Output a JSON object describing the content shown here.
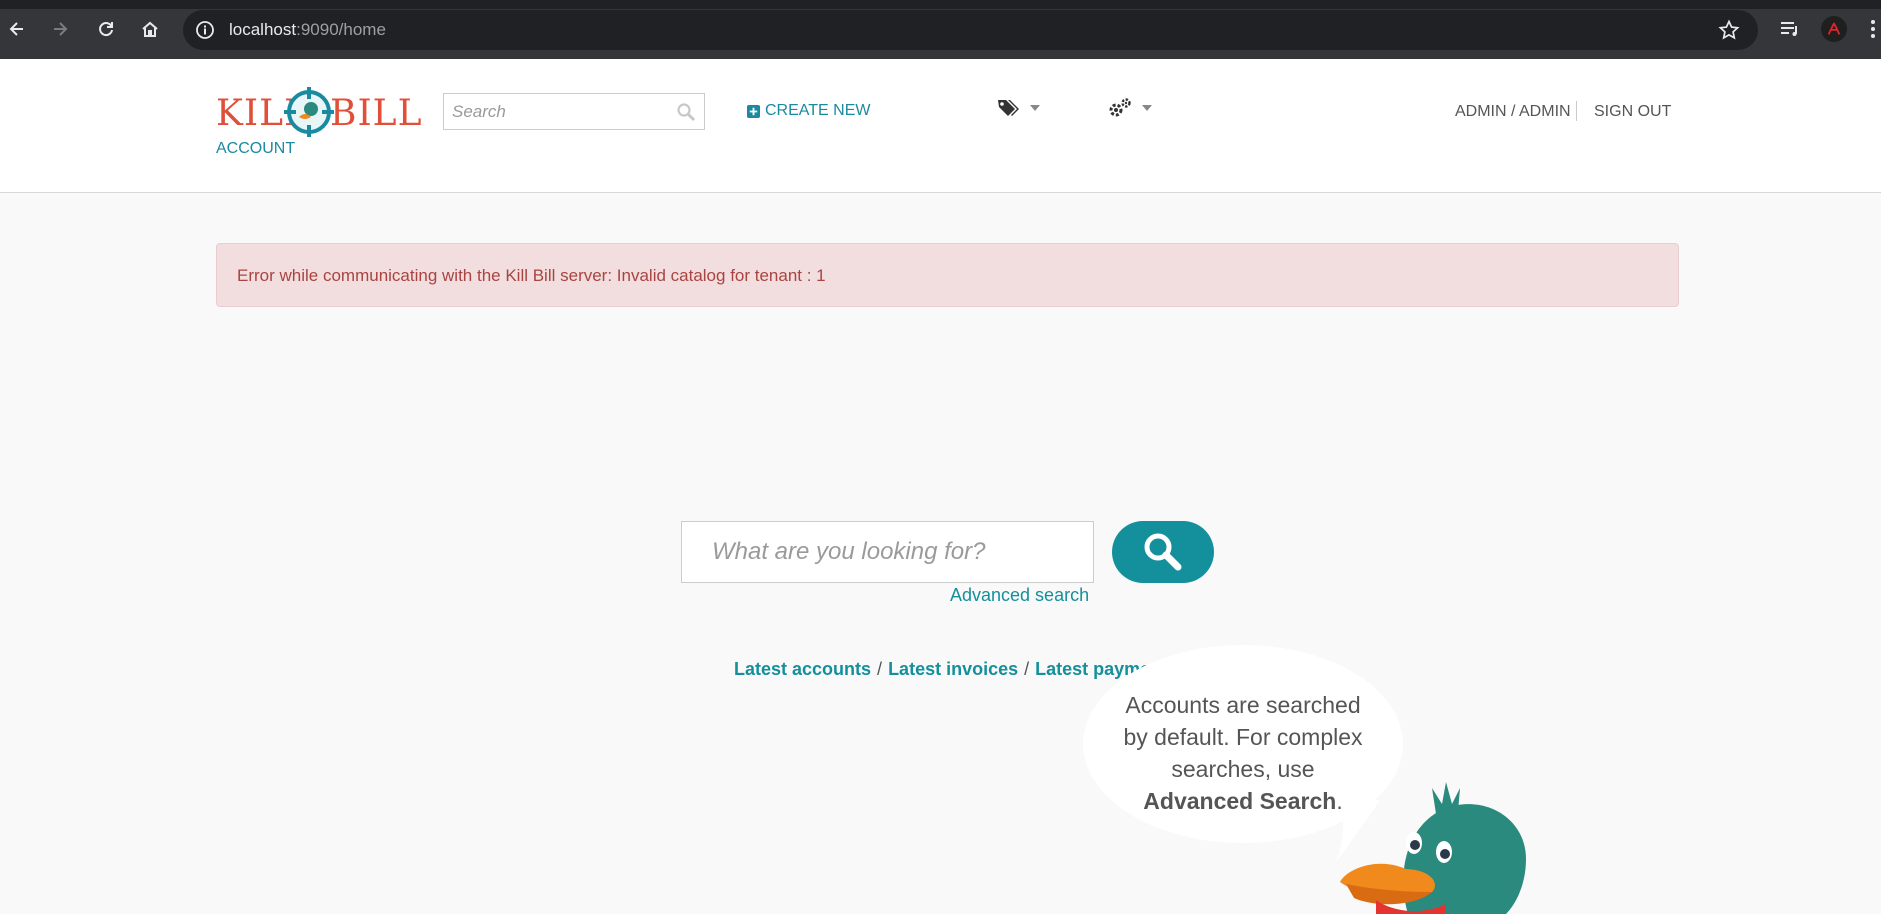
{
  "browser": {
    "url_host": "localhost",
    "url_rest": ":9090/home"
  },
  "header": {
    "logo_left": "KILL",
    "logo_right": "BILL",
    "section_label": "ACCOUNT",
    "search_placeholder": "Search",
    "create_new_label": "CREATE NEW",
    "user_label": "ADMIN / ADMIN",
    "sign_out_label": "SIGN OUT"
  },
  "alert": {
    "message": "Error while communicating with the Kill Bill server: Invalid catalog for tenant : 1"
  },
  "main": {
    "search_placeholder": "What are you looking for?",
    "advanced_search_label": "Advanced search",
    "latest_links": [
      "Latest accounts",
      "Latest invoices",
      "Latest payments"
    ]
  },
  "bubble": {
    "line1": "Accounts are searched",
    "line2": "by default. For complex",
    "line3": "searches, use",
    "bold": "Advanced Search",
    "tail": "."
  },
  "colors": {
    "brand_teal": "#14909c",
    "logo_red": "#e04f3a",
    "alert_bg": "#f2dede",
    "alert_text": "#a94442"
  }
}
